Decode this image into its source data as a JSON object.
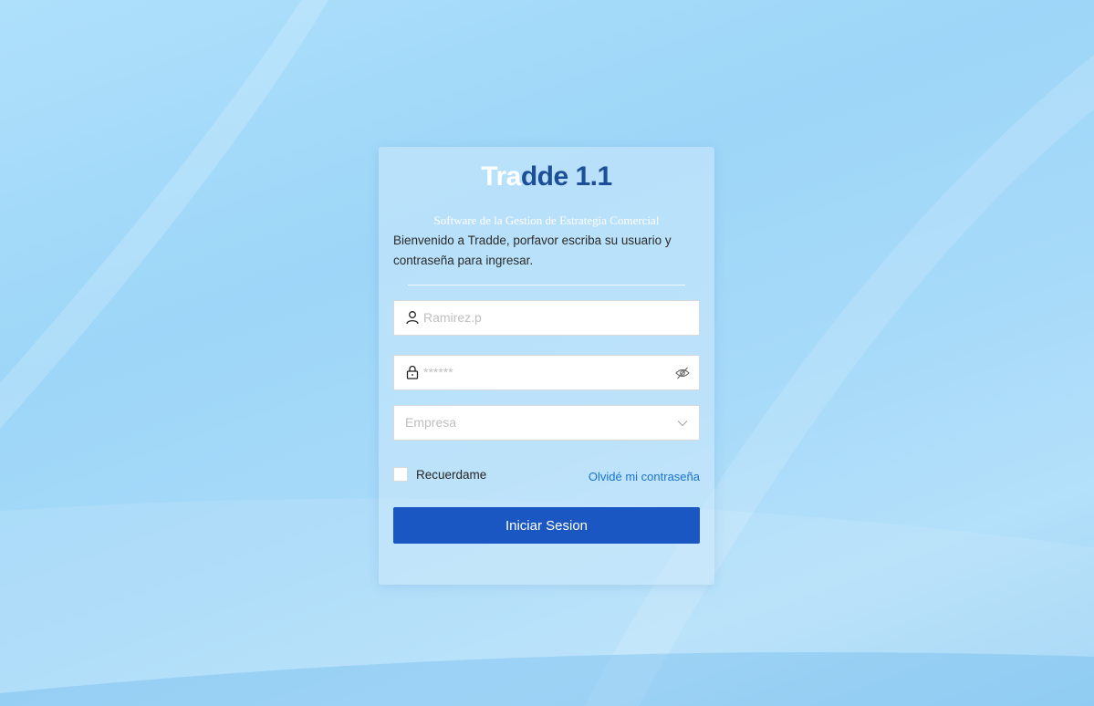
{
  "app": {
    "title_part1": "Tra",
    "title_part2": "dde 1.1",
    "subtitle": "Software de la Gestion de Estrategia Comercial",
    "welcome": "Bienvenido a Tradde, porfavor escriba su usuario y contraseña para ingresar."
  },
  "form": {
    "username_placeholder": "Ramirez.p",
    "password_placeholder": "******",
    "company_placeholder": "Empresa",
    "remember_label": "Recuerdame",
    "forgot_label": "Olvidé mi contraseña",
    "submit_label": "Iniciar Sesion"
  },
  "icons": {
    "user": "user-icon",
    "lock": "lock-icon",
    "eye": "eye-invisible-icon",
    "chevron": "chevron-down-icon"
  },
  "colors": {
    "accent": "#1b57c3",
    "brand_dark": "#1c4f98",
    "link": "#1a73d1"
  }
}
